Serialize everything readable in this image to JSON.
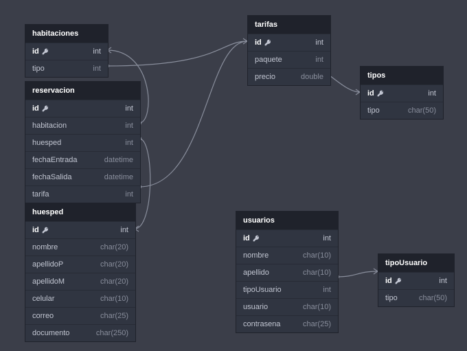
{
  "tables": {
    "habitaciones": {
      "title": "habitaciones",
      "rows": [
        {
          "name": "id",
          "type": "int",
          "pk": true
        },
        {
          "name": "tipo",
          "type": "int"
        }
      ]
    },
    "reservacion": {
      "title": "reservacion",
      "rows": [
        {
          "name": "id",
          "type": "int",
          "pk": true
        },
        {
          "name": "habitacion",
          "type": "int"
        },
        {
          "name": "huesped",
          "type": "int"
        },
        {
          "name": "fechaEntrada",
          "type": "datetime"
        },
        {
          "name": "fechaSalida",
          "type": "datetime"
        },
        {
          "name": "tarifa",
          "type": "int"
        }
      ]
    },
    "huesped": {
      "title": "huesped",
      "rows": [
        {
          "name": "id",
          "type": "int",
          "pk": true
        },
        {
          "name": "nombre",
          "type": "char(20)"
        },
        {
          "name": "apellidoP",
          "type": "char(20)"
        },
        {
          "name": "apellidoM",
          "type": "char(20)"
        },
        {
          "name": "celular",
          "type": "char(10)"
        },
        {
          "name": "correo",
          "type": "char(25)"
        },
        {
          "name": "documento",
          "type": "char(250)"
        }
      ]
    },
    "tarifas": {
      "title": "tarifas",
      "rows": [
        {
          "name": "id",
          "type": "int",
          "pk": true
        },
        {
          "name": "paquete",
          "type": "int"
        },
        {
          "name": "precio",
          "type": "double"
        }
      ]
    },
    "usuarios": {
      "title": "usuarios",
      "rows": [
        {
          "name": "id",
          "type": "int",
          "pk": true
        },
        {
          "name": "nombre",
          "type": "char(10)"
        },
        {
          "name": "apellido",
          "type": "char(10)"
        },
        {
          "name": "tipoUsuario",
          "type": "int"
        },
        {
          "name": "usuario",
          "type": "char(10)"
        },
        {
          "name": "contrasena",
          "type": "char(25)"
        }
      ]
    },
    "tipos": {
      "title": "tipos",
      "rows": [
        {
          "name": "id",
          "type": "int",
          "pk": true
        },
        {
          "name": "tipo",
          "type": "char(50)"
        }
      ]
    },
    "tipoUsuario": {
      "title": "tipoUsuario",
      "rows": [
        {
          "name": "id",
          "type": "int",
          "pk": true
        },
        {
          "name": "tipo",
          "type": "char(50)"
        }
      ]
    }
  },
  "relations": [
    {
      "from": "habitaciones.tipo",
      "to": "tipos.id"
    },
    {
      "from": "reservacion.habitacion",
      "to": "habitaciones.id"
    },
    {
      "from": "reservacion.huesped",
      "to": "huesped.id"
    },
    {
      "from": "reservacion.tarifa",
      "to": "tarifas.id"
    },
    {
      "from": "usuarios.tipoUsuario",
      "to": "tipoUsuario.id"
    }
  ]
}
